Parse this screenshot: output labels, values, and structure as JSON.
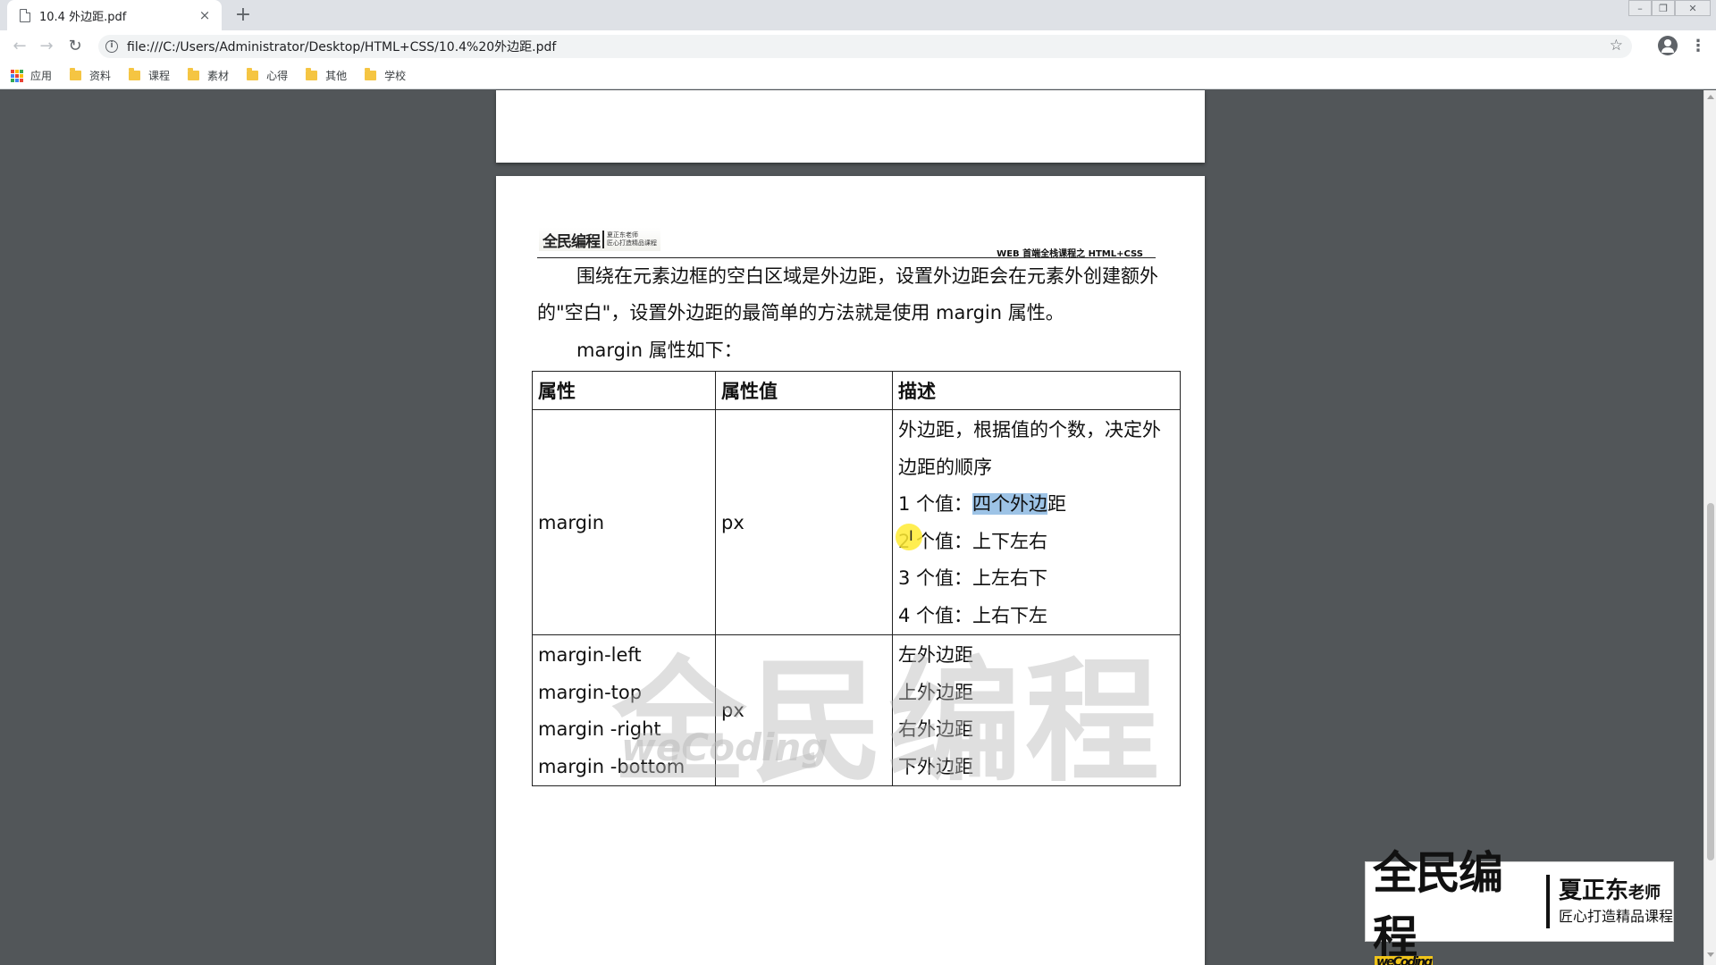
{
  "browser": {
    "tab_title": "10.4 外边距.pdf",
    "tab_close": "×",
    "new_tab": "+",
    "url": "file:///C:/Users/Administrator/Desktop/HTML+CSS/10.4%20外边距.pdf",
    "bookmarks": [
      "应用",
      "资料",
      "课程",
      "素材",
      "心得",
      "其他",
      "学校"
    ]
  },
  "pdf": {
    "header_logo_main": "全民编程",
    "header_logo_name": "夏正东老师",
    "header_logo_slogan": "匠心打造精品课程",
    "header_right": "WEB 首端全栈课程之 HTML+CSS",
    "para1_line1": "围绕在元素边框的空白区域是外边距，设置外边距会在元素外创建额外",
    "para1_line2": "的\"空白\"，设置外边距的最简单的方法就是使用 margin 属性。",
    "para2": "margin 属性如下：",
    "table": {
      "headers": [
        "属性",
        "属性值",
        "描述"
      ],
      "row1": {
        "property": "margin",
        "value": "px",
        "desc_line1": "外边距，根据值的个数，决定外",
        "desc_line2": "边距的顺序",
        "desc_line3_prefix": "1 个值：",
        "desc_line3_highlight": "四个外边",
        "desc_line3_suffix": "距",
        "desc_line4": "2 个值：上下左右",
        "desc_line5": "3 个值：上左右下",
        "desc_line6": "4 个值：上右下左"
      },
      "row2": {
        "properties": [
          "margin-left",
          "margin-top",
          "margin -right",
          "margin -bottom"
        ],
        "value": "px",
        "descs": [
          "左外边距",
          "上外边距",
          "右外边距",
          "下外边距"
        ]
      }
    },
    "watermark_cn": "全民编程",
    "watermark_en": "weCoding"
  },
  "brand": {
    "main": "全民编程",
    "en": "weCoding",
    "name": "夏正东",
    "title": "老师",
    "slogan": "匠心打造精品课程"
  }
}
